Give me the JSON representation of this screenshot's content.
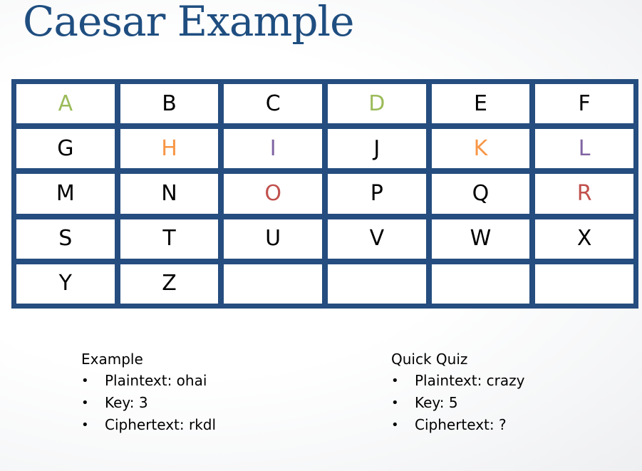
{
  "slide": {
    "title": "Caesar Example",
    "colors": {
      "title": "#1f4e80",
      "grid_border": "#254d7f",
      "green": "#9bbb59",
      "orange": "#f79646",
      "purple": "#8064a2",
      "red": "#c0504d",
      "default": "#000000"
    },
    "alphabet_grid": [
      {
        "letter": "A",
        "color": "green"
      },
      {
        "letter": "B",
        "color": "default"
      },
      {
        "letter": "C",
        "color": "default"
      },
      {
        "letter": "D",
        "color": "green"
      },
      {
        "letter": "E",
        "color": "default"
      },
      {
        "letter": "F",
        "color": "default"
      },
      {
        "letter": "G",
        "color": "default"
      },
      {
        "letter": "H",
        "color": "orange"
      },
      {
        "letter": "I",
        "color": "purple"
      },
      {
        "letter": "J",
        "color": "default"
      },
      {
        "letter": "K",
        "color": "orange"
      },
      {
        "letter": "L",
        "color": "purple"
      },
      {
        "letter": "M",
        "color": "default"
      },
      {
        "letter": "N",
        "color": "default"
      },
      {
        "letter": "O",
        "color": "red"
      },
      {
        "letter": "P",
        "color": "default"
      },
      {
        "letter": "Q",
        "color": "default"
      },
      {
        "letter": "R",
        "color": "red"
      },
      {
        "letter": "S",
        "color": "default"
      },
      {
        "letter": "T",
        "color": "default"
      },
      {
        "letter": "U",
        "color": "default"
      },
      {
        "letter": "V",
        "color": "default"
      },
      {
        "letter": "W",
        "color": "default"
      },
      {
        "letter": "X",
        "color": "default"
      },
      {
        "letter": "Y",
        "color": "default"
      },
      {
        "letter": "Z",
        "color": "default"
      },
      {
        "letter": "",
        "color": "default"
      },
      {
        "letter": "",
        "color": "default"
      },
      {
        "letter": "",
        "color": "default"
      },
      {
        "letter": "",
        "color": "default"
      }
    ],
    "example": {
      "heading": "Example",
      "bullet": "•",
      "items": [
        "Plaintext: ohai",
        "Key: 3",
        "Ciphertext: rkdl"
      ]
    },
    "quiz": {
      "heading": "Quick Quiz",
      "bullet": "•",
      "items": [
        "Plaintext: crazy",
        "Key: 5",
        "Ciphertext: ?"
      ]
    }
  }
}
